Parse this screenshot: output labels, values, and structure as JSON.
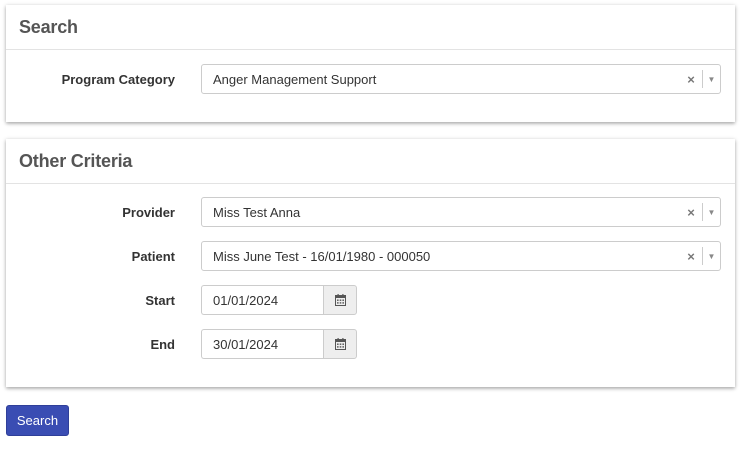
{
  "search_panel": {
    "title": "Search",
    "program_category": {
      "label": "Program Category",
      "value": "Anger Management Support",
      "clear_glyph": "×",
      "arrow_glyph": "▼"
    }
  },
  "criteria_panel": {
    "title": "Other Criteria",
    "provider": {
      "label": "Provider",
      "value": "Miss Test Anna",
      "clear_glyph": "×",
      "arrow_glyph": "▼"
    },
    "patient": {
      "label": "Patient",
      "value": "Miss June Test - 16/01/1980 - 000050",
      "clear_glyph": "×",
      "arrow_glyph": "▼"
    },
    "start": {
      "label": "Start",
      "value": "01/01/2024",
      "icon": "calendar-icon"
    },
    "end": {
      "label": "End",
      "value": "30/01/2024",
      "icon": "calendar-icon"
    }
  },
  "actions": {
    "search_label": "Search"
  },
  "colors": {
    "primary_button": "#3a4db3",
    "panel_title": "#555555",
    "border": "#cccccc",
    "addon_bg": "#eeeeee"
  }
}
